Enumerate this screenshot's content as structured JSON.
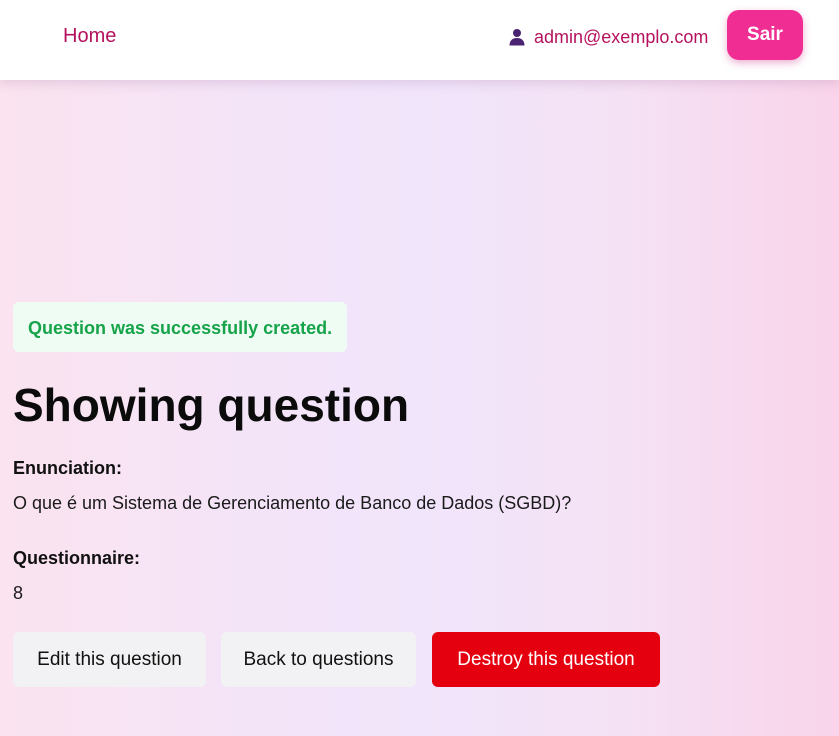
{
  "nav": {
    "home_label": "Home",
    "user_email": "admin@exemplo.com",
    "logout_label": "Sair",
    "user_icon": "user-icon"
  },
  "notice": {
    "message": "Question was successfully created."
  },
  "page": {
    "title": "Showing question"
  },
  "question": {
    "enunciation_label": "Enunciation:",
    "enunciation_value": "O que é um Sistema de Gerenciamento de Banco de Dados (SGBD)?",
    "questionnaire_label": "Questionnaire:",
    "questionnaire_value": "8"
  },
  "actions": {
    "edit_label": "Edit this question",
    "back_label": "Back to questions",
    "destroy_label": "Destroy this question"
  },
  "colors": {
    "brand_pink": "#ef2d92",
    "link_color": "#b5125e",
    "success_text": "#16a34a",
    "success_bg": "#effcf3",
    "danger": "#e5000f"
  }
}
